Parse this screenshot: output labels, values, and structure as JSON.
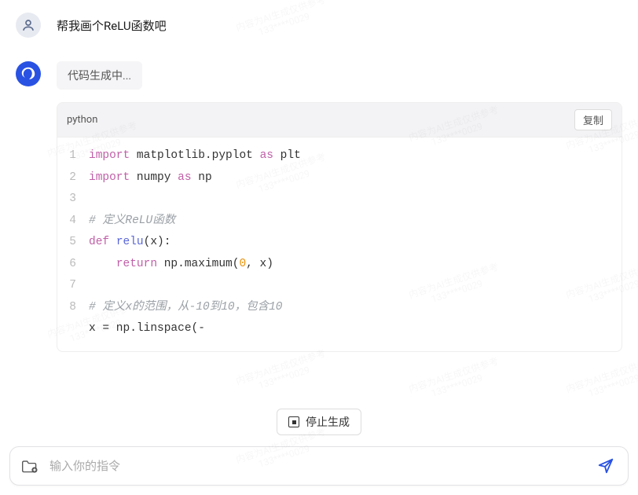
{
  "user": {
    "message": "帮我画个ReLU函数吧"
  },
  "assistant": {
    "status": "代码生成中..."
  },
  "code": {
    "language": "python",
    "copy_label": "复制",
    "lines": [
      {
        "n": "1",
        "html": "<span class='kw'>import</span> <span class='lib'>matplotlib.pyplot</span> <span class='kw'>as</span> <span class='lib'>plt</span>"
      },
      {
        "n": "2",
        "html": "<span class='kw'>import</span> <span class='lib'>numpy</span> <span class='kw'>as</span> <span class='lib'>np</span>"
      },
      {
        "n": "3",
        "html": ""
      },
      {
        "n": "4",
        "html": "<span class='com'># 定义ReLU函数</span>"
      },
      {
        "n": "5",
        "html": "<span class='kw'>def</span> <span class='fn'>relu</span><span class='par'>(x):</span>"
      },
      {
        "n": "6",
        "html": "    <span class='kw'>return</span> np.maximum(<span class='num'>0</span>, x)"
      },
      {
        "n": "7",
        "html": ""
      },
      {
        "n": "8",
        "html": "<span class='com'># 定义x的范围，从-10到10，包含10</span>"
      },
      {
        "n": "",
        "html": "x = np.linspace(-"
      }
    ]
  },
  "controls": {
    "stop_label": "停止生成"
  },
  "input": {
    "placeholder": "输入你的指令"
  },
  "watermark": {
    "line1": "内容为AI生成仅供参考",
    "line2": "133****0029"
  }
}
